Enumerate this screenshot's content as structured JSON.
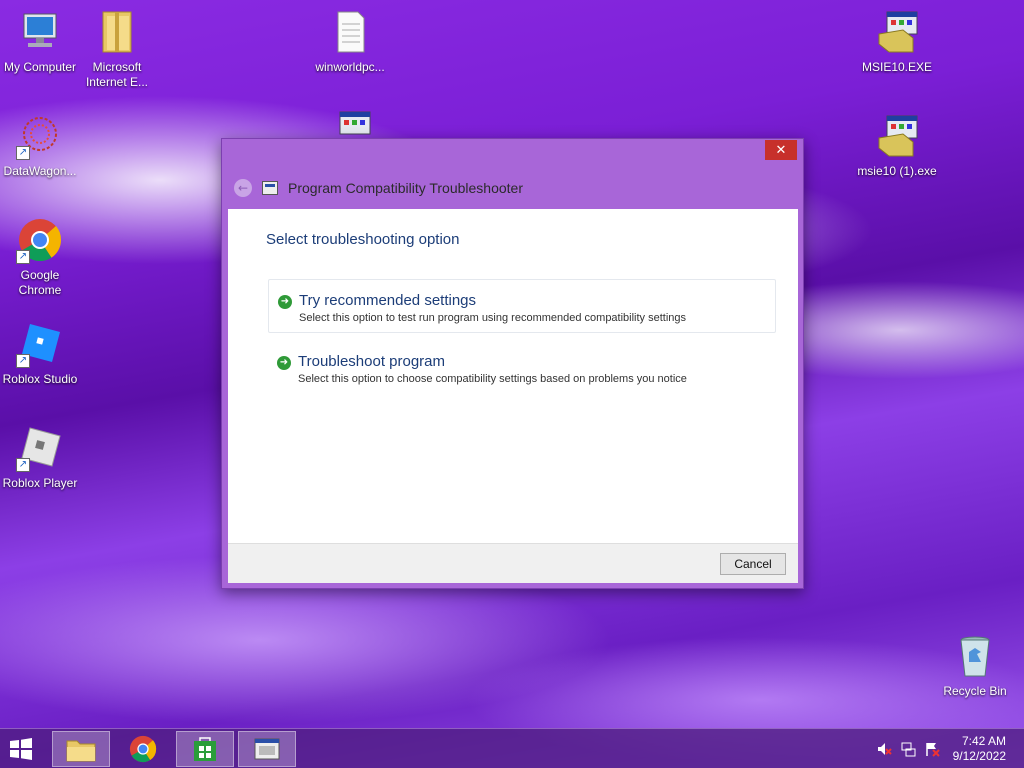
{
  "desktop": {
    "icons": [
      {
        "label": "My Computer"
      },
      {
        "label": "Microsoft Internet E..."
      },
      {
        "label": "winworldpc..."
      },
      {
        "label": "MSIE10.EXE"
      },
      {
        "label": "DataWagon..."
      },
      {
        "label": "msie10 (1).exe"
      },
      {
        "label": "Google Chrome"
      },
      {
        "label": "Roblox Studio"
      },
      {
        "label": "Roblox Player"
      },
      {
        "label": "Recycle Bin"
      }
    ]
  },
  "dialog": {
    "title": "Program Compatibility Troubleshooter",
    "close_label": "✕",
    "section_title": "Select troubleshooting option",
    "options": [
      {
        "title": "Try recommended settings",
        "description": "Select this option to test run program using recommended compatibility settings"
      },
      {
        "title": "Troubleshoot program",
        "description": "Select this option to choose compatibility settings based on problems you notice"
      }
    ],
    "cancel_label": "Cancel"
  },
  "taskbar": {
    "time": "7:42 AM",
    "date": "9/12/2022"
  },
  "colors": {
    "accent": "#a866d8",
    "close": "#c7302b",
    "link_text": "#1c3d78",
    "arrow_green": "#2f9a38"
  }
}
